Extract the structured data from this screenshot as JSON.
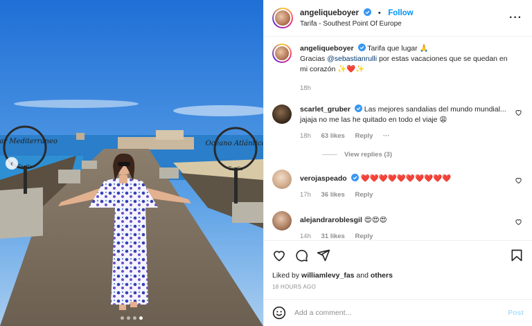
{
  "header": {
    "username": "angeliqueboyer",
    "follow_label": "Follow",
    "separator": "•",
    "location": "Tarifa - Southest Point Of Europe",
    "more_label": "···"
  },
  "caption": {
    "username": "angeliqueboyer",
    "line1": "Tarifa que lugar 🙏",
    "prefix": "Gracias ",
    "mention": "@sebastianrulli",
    "suffix": " por estas vacaciones que se quedan en mi corazón ✨❤️✨",
    "time": "18h"
  },
  "comments": [
    {
      "username": "scarlet_gruber",
      "text": "Las mejores sandalias del mundo mundial... jajaja no me las he quitado en todo el viaje 😩",
      "time": "18h",
      "likes": "63 likes",
      "reply": "Reply",
      "more": "···",
      "view_replies": "View replies (3)"
    },
    {
      "username": "verojaspeado",
      "text": "❤️❤️❤️❤️❤️❤️❤️❤️❤️❤️",
      "time": "17h",
      "likes": "36 likes",
      "reply": "Reply"
    },
    {
      "username": "alejandraroblesgil",
      "text": "😍😍😍",
      "time": "14h",
      "likes": "31 likes",
      "reply": "Reply"
    }
  ],
  "footer": {
    "liked_prefix": "Liked by ",
    "liked_user": "williamlevy_fas",
    "liked_and": " and ",
    "liked_others": "others",
    "time_ago": "18 HOURS AGO",
    "add_comment_placeholder": "Add a comment...",
    "post_label": "Post"
  },
  "photo": {
    "sign_left": "Mar Mediterráneo",
    "sign_left_sub": "Tarifa",
    "sign_right": "Océano Atlántico",
    "sign_right_sub": "Tarifa",
    "carousel_dots": 4,
    "active_dot": 3
  },
  "colors": {
    "accent": "#0095f6",
    "verified": "#3897f0",
    "sky": "#3f86d9",
    "muted": "#8e8e8e"
  }
}
